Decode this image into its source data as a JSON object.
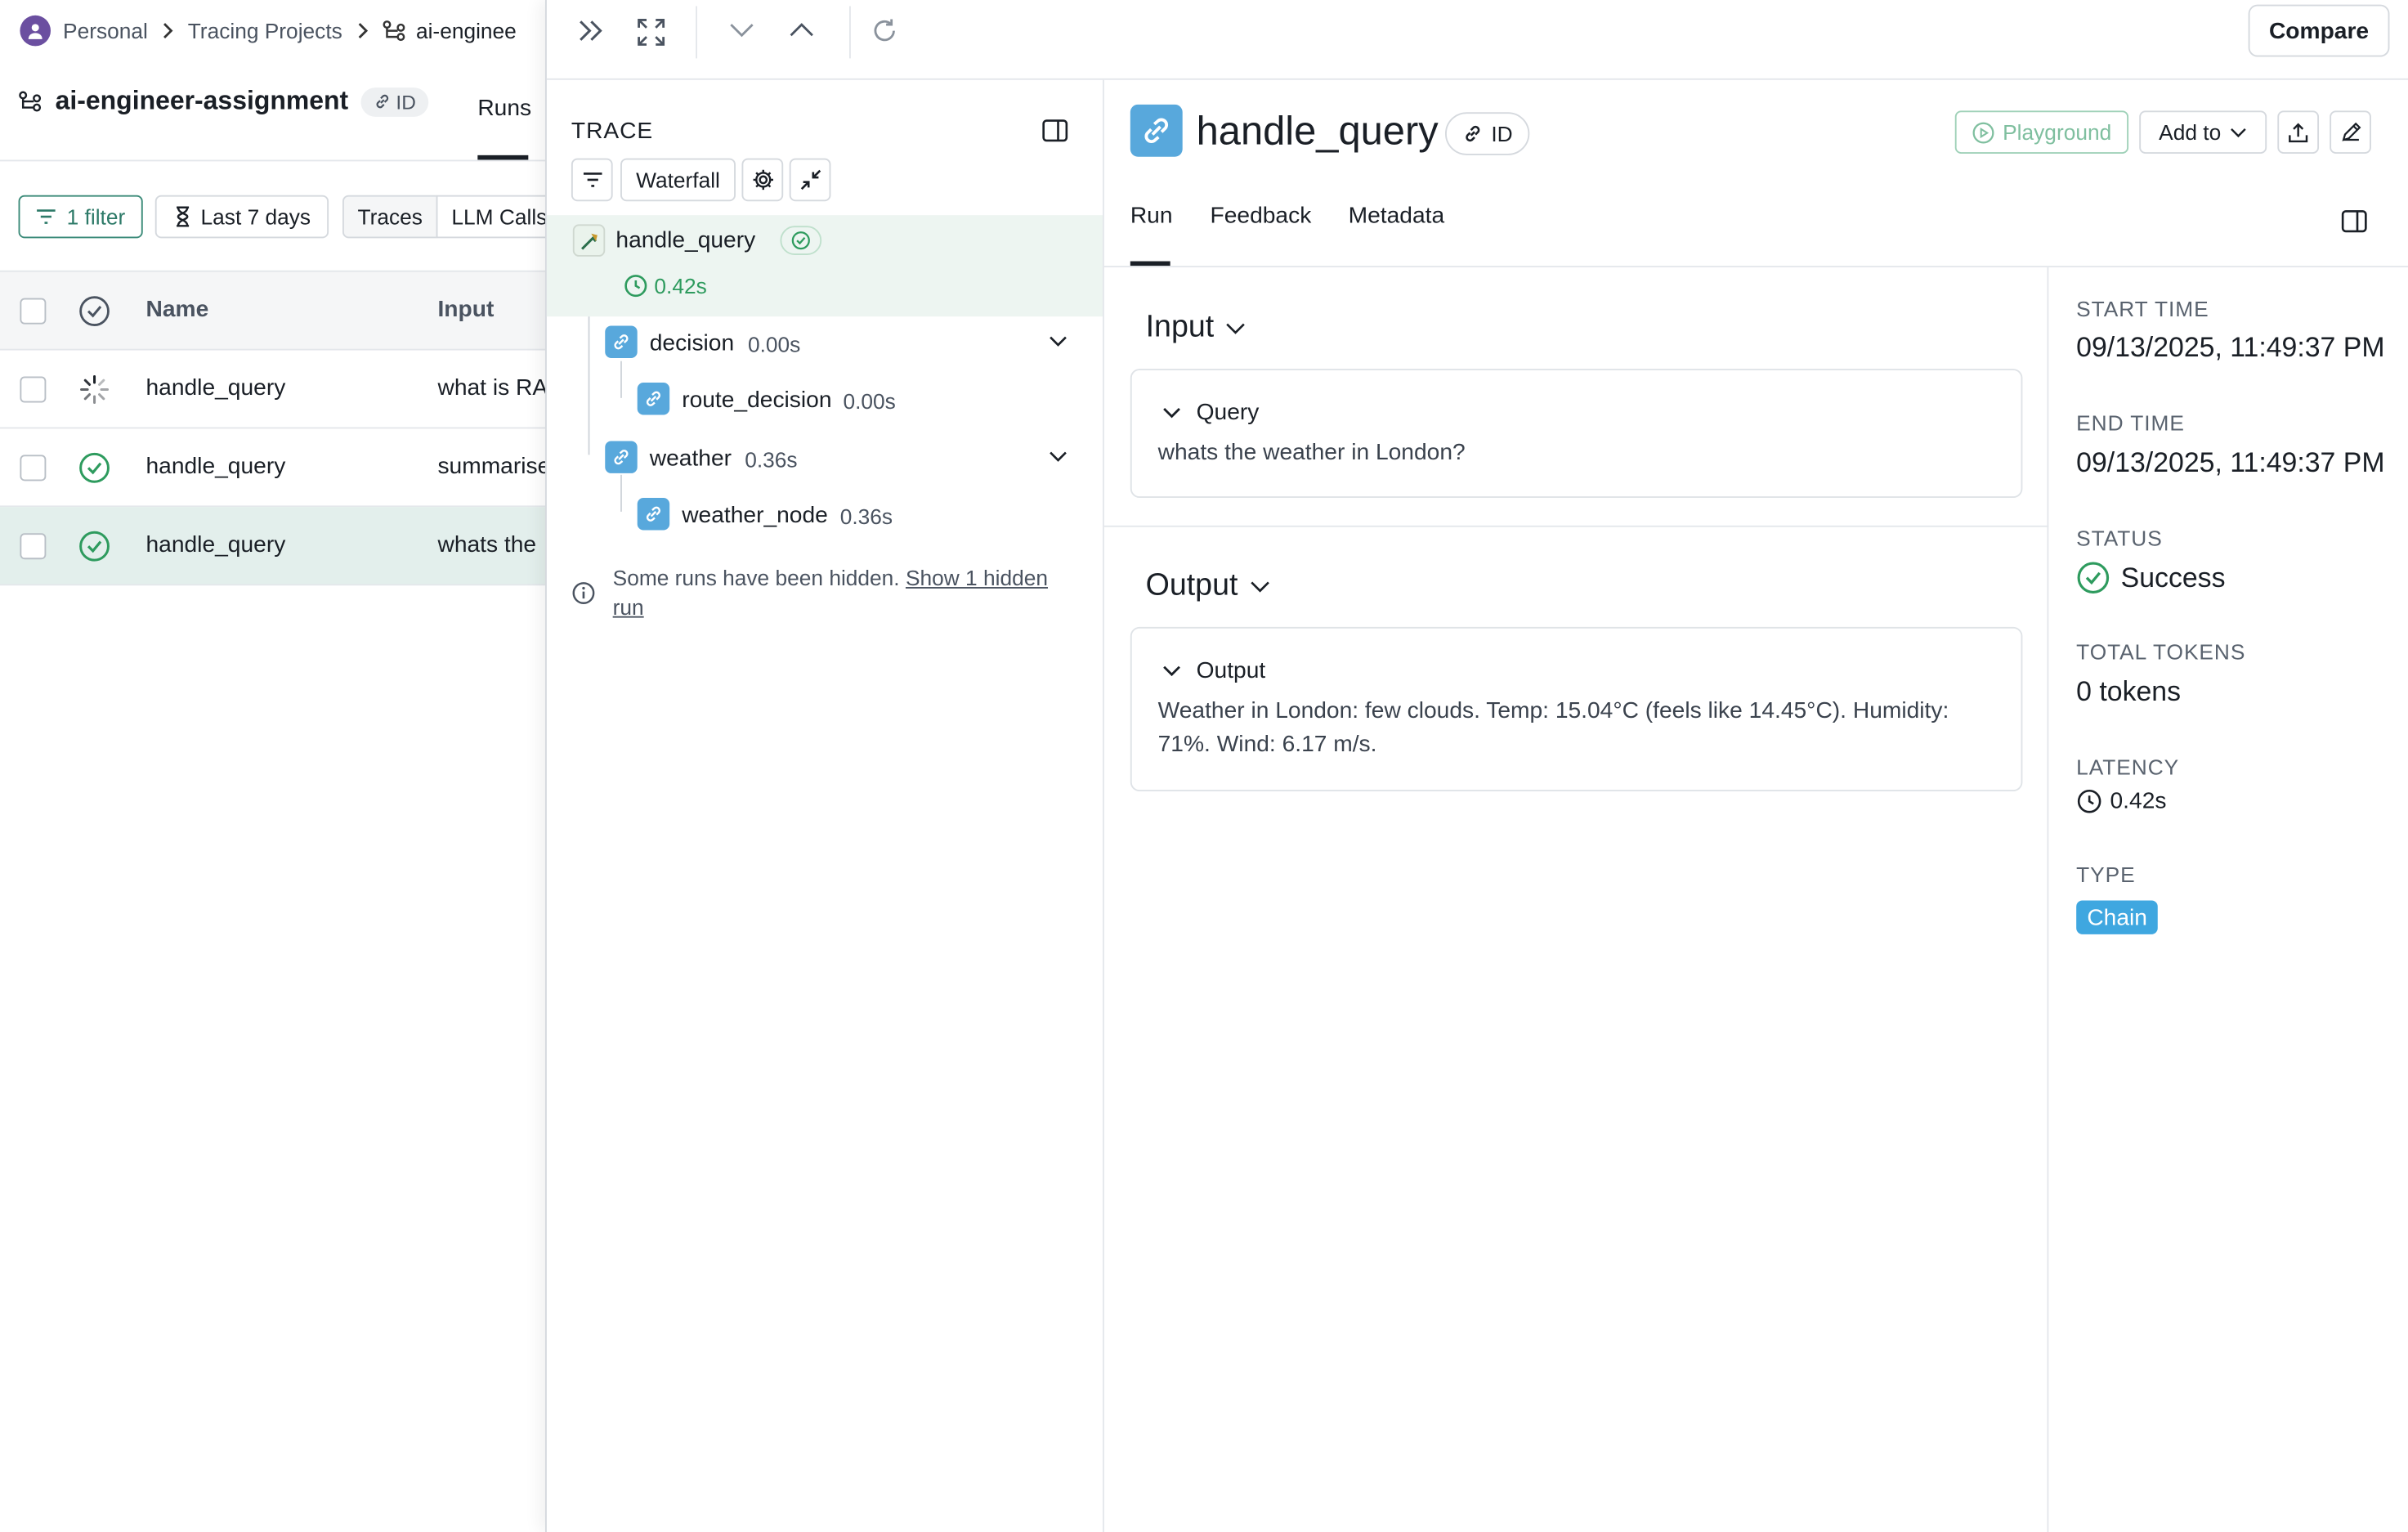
{
  "breadcrumb": {
    "workspace": "Personal",
    "section": "Tracing Projects",
    "project": "ai-enginee"
  },
  "project": {
    "name": "ai-engineer-assignment",
    "id_label": "ID",
    "active_tab": "Runs"
  },
  "filters": {
    "filter_label": "1 filter",
    "date_label": "Last 7 days",
    "seg_traces": "Traces",
    "seg_llm": "LLM Calls"
  },
  "table": {
    "headers": {
      "name": "Name",
      "input": "Input"
    },
    "rows": [
      {
        "name": "handle_query",
        "input": "what is RAG",
        "status": "running"
      },
      {
        "name": "handle_query",
        "input": "summarise",
        "status": "success"
      },
      {
        "name": "handle_query",
        "input": "whats the",
        "status": "success"
      }
    ]
  },
  "toolbar": {
    "compare_label": "Compare"
  },
  "trace": {
    "title": "TRACE",
    "view_label": "Waterfall",
    "root": {
      "name": "handle_query",
      "latency": "0.42s"
    },
    "nodes": [
      {
        "name": "decision",
        "time": "0.00s"
      },
      {
        "name": "route_decision",
        "time": "0.00s"
      },
      {
        "name": "weather",
        "time": "0.36s"
      },
      {
        "name": "weather_node",
        "time": "0.36s"
      }
    ],
    "hidden_note": "Some runs have been hidden. ",
    "hidden_link": "Show 1 hidden run"
  },
  "detail": {
    "title": "handle_query",
    "id_label": "ID",
    "playground_label": "Playground",
    "add_to_label": "Add to",
    "tabs": [
      "Run",
      "Feedback",
      "Metadata"
    ],
    "input": {
      "heading": "Input",
      "field_label": "Query",
      "value": "whats the weather in London?"
    },
    "output": {
      "heading": "Output",
      "field_label": "Output",
      "value": "Weather in London: few clouds. Temp: 15.04°C (feels like 14.45°C). Humidity: 71%. Wind: 6.17 m/s."
    }
  },
  "meta": {
    "start_label": "START TIME",
    "start_value": "09/13/2025, 11:49:37 PM",
    "end_label": "END TIME",
    "end_value": "09/13/2025, 11:49:37 PM",
    "status_label": "STATUS",
    "status_value": "Success",
    "tokens_label": "TOTAL TOKENS",
    "tokens_value": "0 tokens",
    "latency_label": "LATENCY",
    "latency_value": "0.42s",
    "type_label": "TYPE",
    "type_value": "Chain"
  },
  "colors": {
    "success": "#2e9b5e",
    "chain_icon": "#58a8dc",
    "type_chip": "#3fa7e0",
    "selected_row": "#e3efec"
  }
}
